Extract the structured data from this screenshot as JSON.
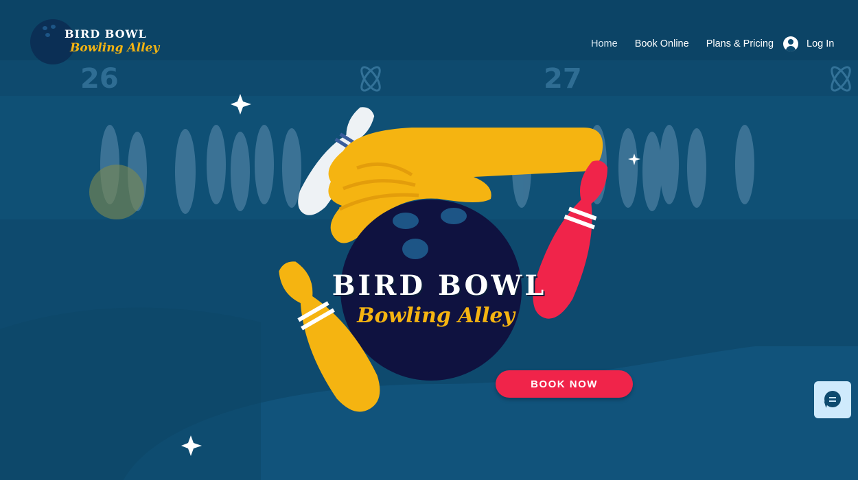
{
  "brand": {
    "name_line1": "BIRD BOWL",
    "name_line2": "Bowling Alley"
  },
  "nav": {
    "items": [
      {
        "label": "Home",
        "active": true
      },
      {
        "label": "Book Online",
        "active": false
      },
      {
        "label": "Plans & Pricing",
        "active": false
      }
    ],
    "login_label": "Log In"
  },
  "hero": {
    "title": "BIRD BOWL",
    "subtitle": "Bowling Alley",
    "cta_label": "BOOK NOW",
    "lane_numbers": [
      "26",
      "27"
    ]
  },
  "icons": {
    "login": "user-avatar-icon",
    "chat": "chat-icon",
    "sparkle": "sparkle-icon"
  },
  "colors": {
    "background": "#0e4a6e",
    "accent_yellow": "#f5b411",
    "accent_red": "#f0244a",
    "ball": "#0f1240"
  }
}
